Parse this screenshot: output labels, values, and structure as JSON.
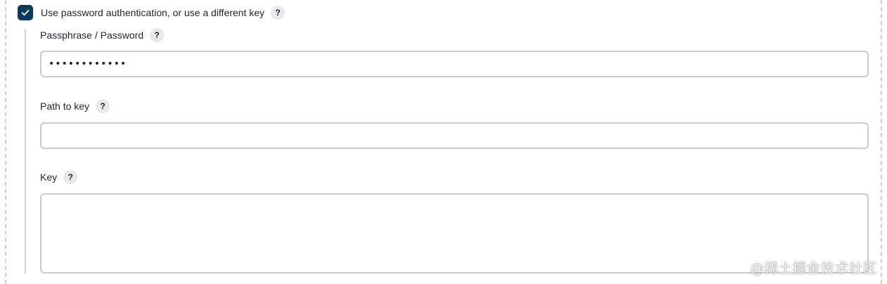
{
  "auth": {
    "checkbox_label": "Use password authentication, or use a different key",
    "checked": true
  },
  "help_glyph": "?",
  "fields": {
    "passphrase": {
      "label": "Passphrase / Password",
      "value": "••••••••••••"
    },
    "path_to_key": {
      "label": "Path to key",
      "value": ""
    },
    "key": {
      "label": "Key",
      "value": ""
    }
  },
  "colors": {
    "checkbox_fill": "#0b3a5d",
    "border": "#cbcbcf"
  },
  "watermark": "@稀土掘金技术社区"
}
